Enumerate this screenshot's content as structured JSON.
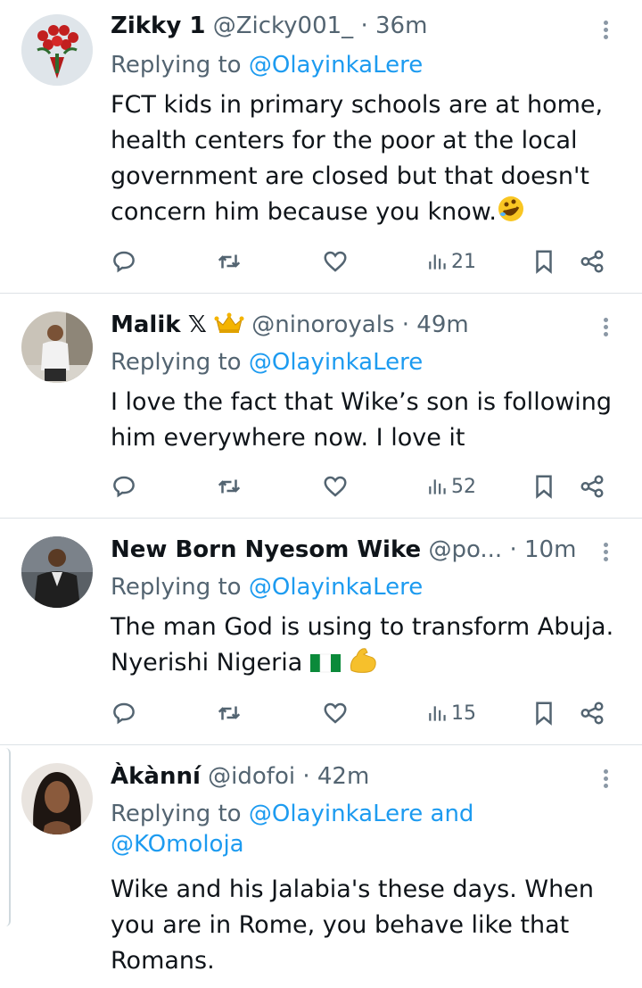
{
  "tweets": [
    {
      "name": "Zikky 1",
      "badge": "",
      "handle": "@Zicky001_",
      "time": "36m",
      "replying_prefix": "Replying to ",
      "replying_to": "@OlayinkaLere",
      "text_lines": [
        "FCT kids in primary schools are at home,",
        "health centers for the poor at the local",
        "government are closed but that doesn't",
        "concern him because you know."
      ],
      "emoji": "rofl",
      "views": "21"
    },
    {
      "name": "Malik",
      "badge": "𝕏",
      "handle": "@ninoroyals",
      "time": "49m",
      "replying_prefix": "Replying to ",
      "replying_to": "@OlayinkaLere",
      "text_lines": [
        "I love the fact that Wike’s son is following",
        "him everywhere now. I love it"
      ],
      "views": "52"
    },
    {
      "name": "New Born Nyesom Wike",
      "handle": "@po...",
      "time": "10m",
      "replying_prefix": "Replying to ",
      "replying_to": "@OlayinkaLere",
      "text_lines": [
        "The man God is using to transform Abuja.",
        "Nyerishi Nigeria"
      ],
      "views": "15"
    },
    {
      "name": "Àkànní",
      "handle": "@idofoi",
      "time": "42m",
      "replying_prefix": "Replying to ",
      "replying_to": "@OlayinkaLere and",
      "replying_to_2": "@KOmoloja",
      "text_lines": [
        "Wike and his Jalabia's these days. When",
        "you are in Rome, you behave like that",
        "Romans."
      ]
    }
  ],
  "separator": "·",
  "icons": [
    "reply-icon",
    "retweet-icon",
    "like-icon",
    "views-icon",
    "bookmark-icon",
    "share-icon",
    "more-icon",
    "crown-icon",
    "nigeria-flag-icon",
    "flexed-biceps-icon"
  ],
  "colors": {
    "link": "#1d9bf0",
    "muted": "#536471",
    "text": "#0f1419",
    "divider": "#dde2e6"
  }
}
